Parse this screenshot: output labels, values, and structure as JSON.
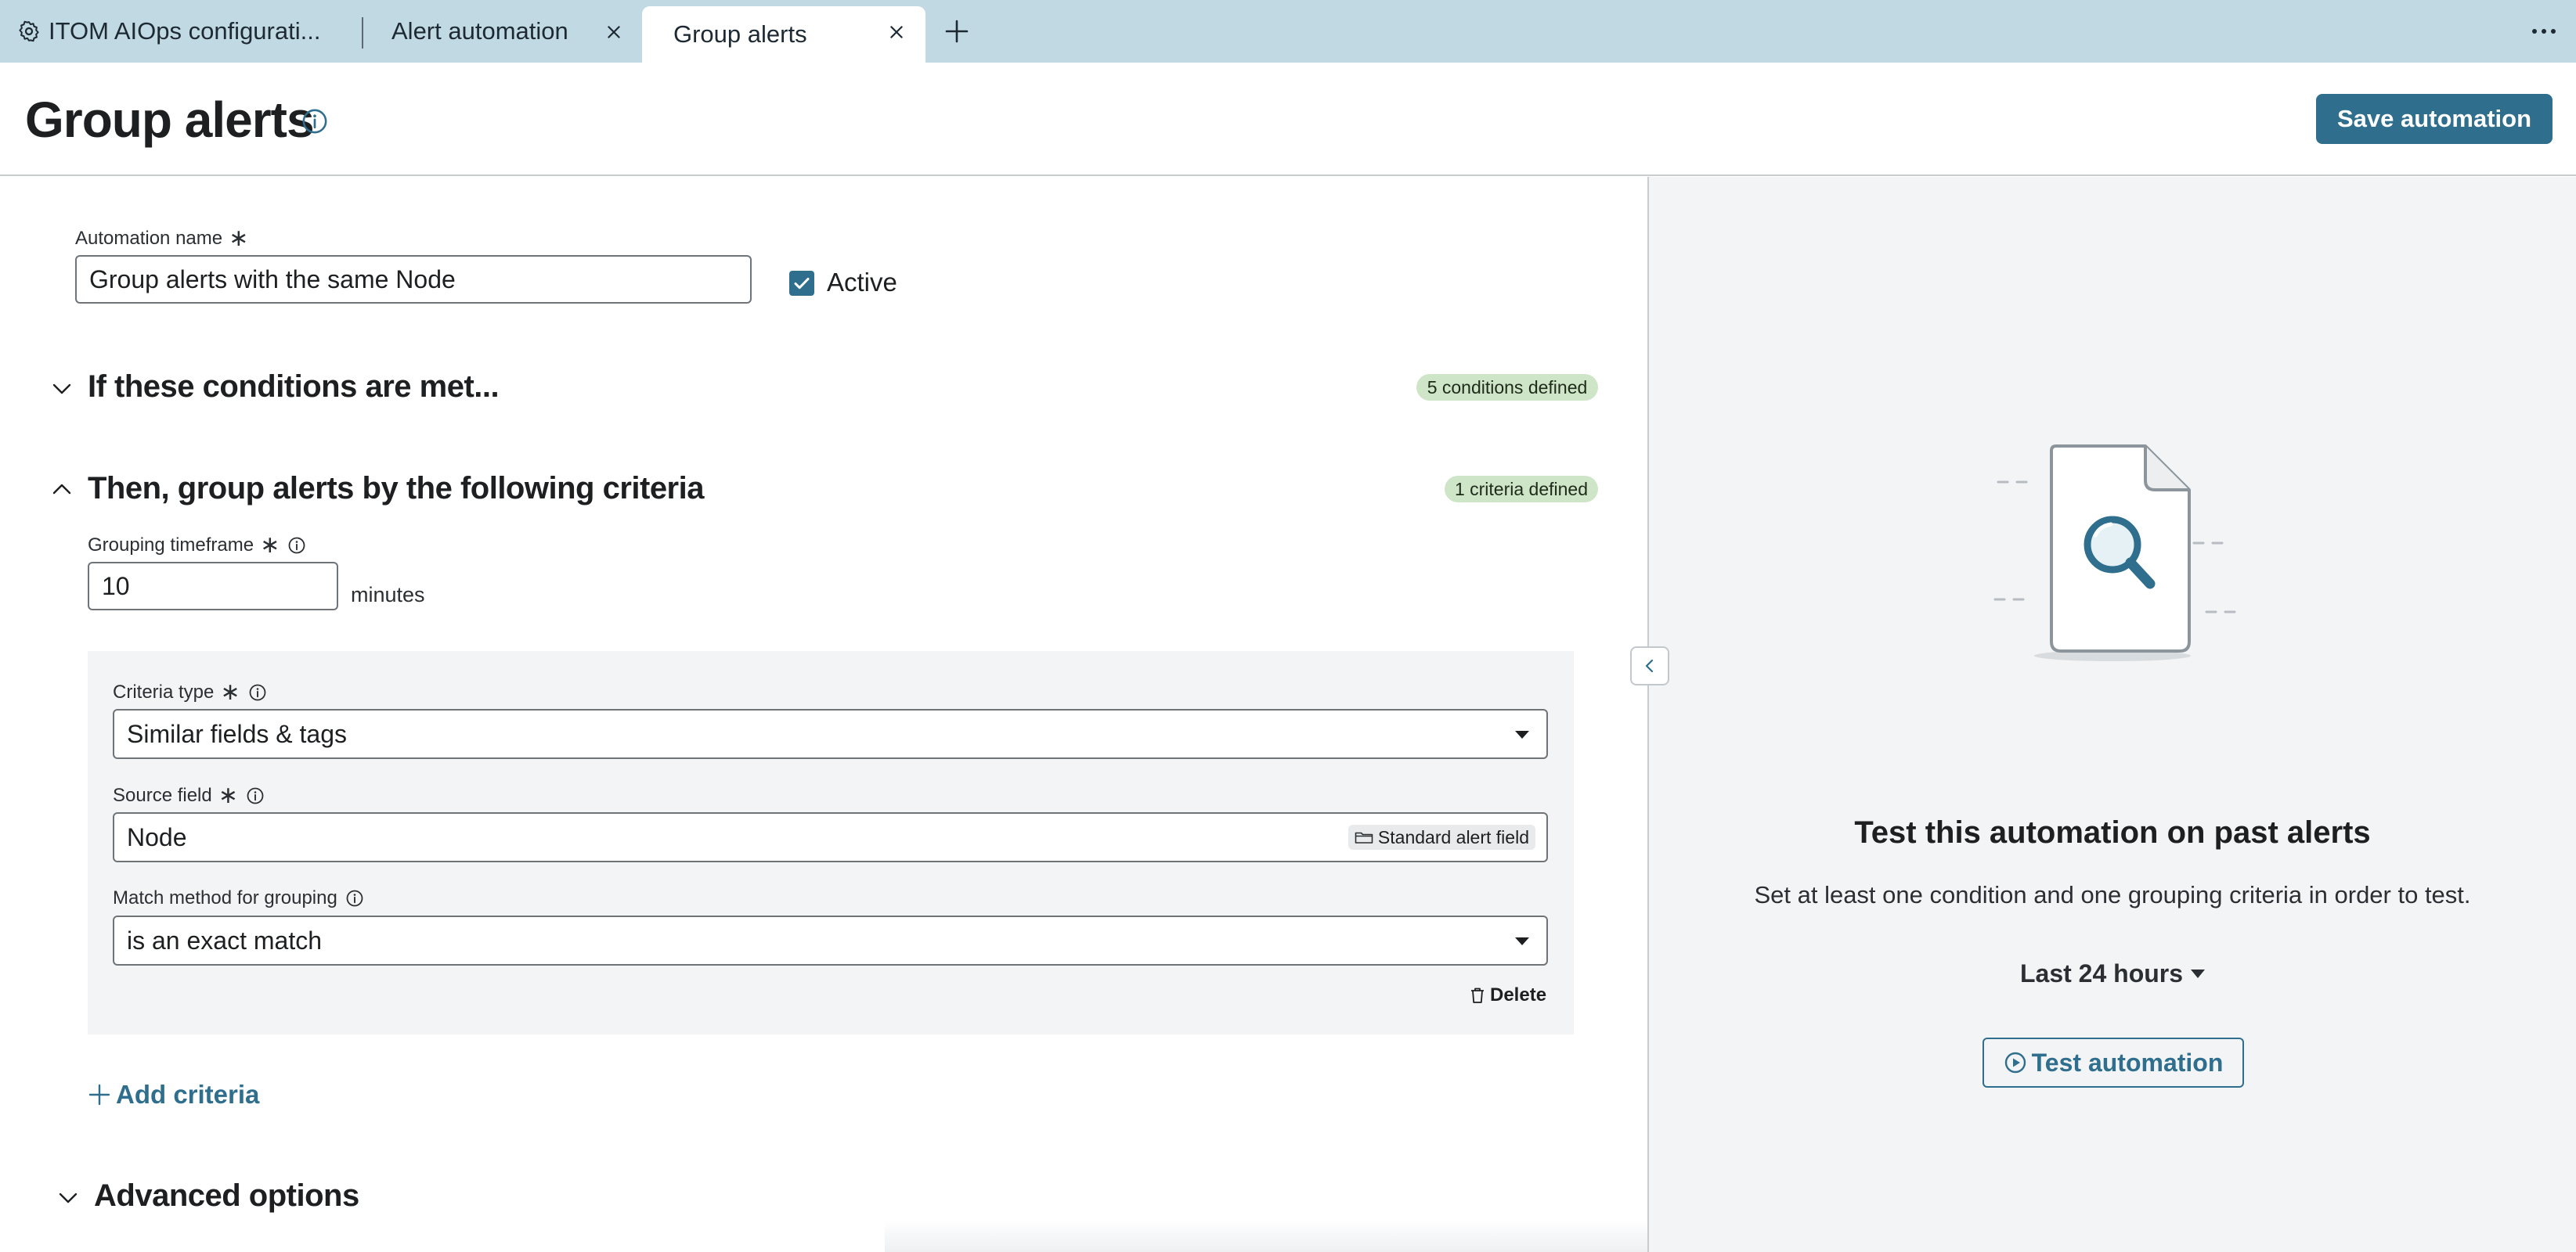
{
  "tabs": [
    {
      "label": "ITOM AIOps configurati...",
      "icon": "gear-icon",
      "active": false
    },
    {
      "label": "Alert automation",
      "closable": true,
      "active": false
    },
    {
      "label": "Group alerts",
      "closable": true,
      "active": true
    }
  ],
  "header": {
    "title": "Group alerts",
    "save_label": "Save automation"
  },
  "form": {
    "automation_name_label": "Automation name",
    "automation_name_value": "Group alerts with the same Node",
    "active_label": "Active",
    "active_checked": true,
    "required_mark": "∗"
  },
  "conditions": {
    "title": "If these conditions are met...",
    "badge": "5 conditions defined",
    "expanded": false
  },
  "grouping": {
    "title": "Then, group alerts by the following criteria",
    "badge": "1 criteria defined",
    "expanded": true,
    "timeframe_label": "Grouping timeframe",
    "timeframe_value": "10",
    "timeframe_unit": "minutes",
    "criteria": {
      "type_label": "Criteria type",
      "type_value": "Similar fields & tags",
      "source_label": "Source field",
      "source_value": "Node",
      "source_tag": "Standard alert field",
      "match_label": "Match method for grouping",
      "match_value": "is an exact match",
      "delete_label": "Delete"
    },
    "add_criteria_label": "Add criteria"
  },
  "advanced": {
    "title": "Advanced options",
    "expanded": false
  },
  "test_panel": {
    "title": "Test this automation on past alerts",
    "description": "Set at least one condition and one grouping criteria in order to test.",
    "range_value": "Last 24 hours",
    "test_button_label": "Test automation"
  },
  "colors": {
    "accent": "#2f6f8d",
    "tabbar": "#c1d9e2",
    "badge": "#cfe5c7",
    "panel": "#f3f4f5"
  }
}
